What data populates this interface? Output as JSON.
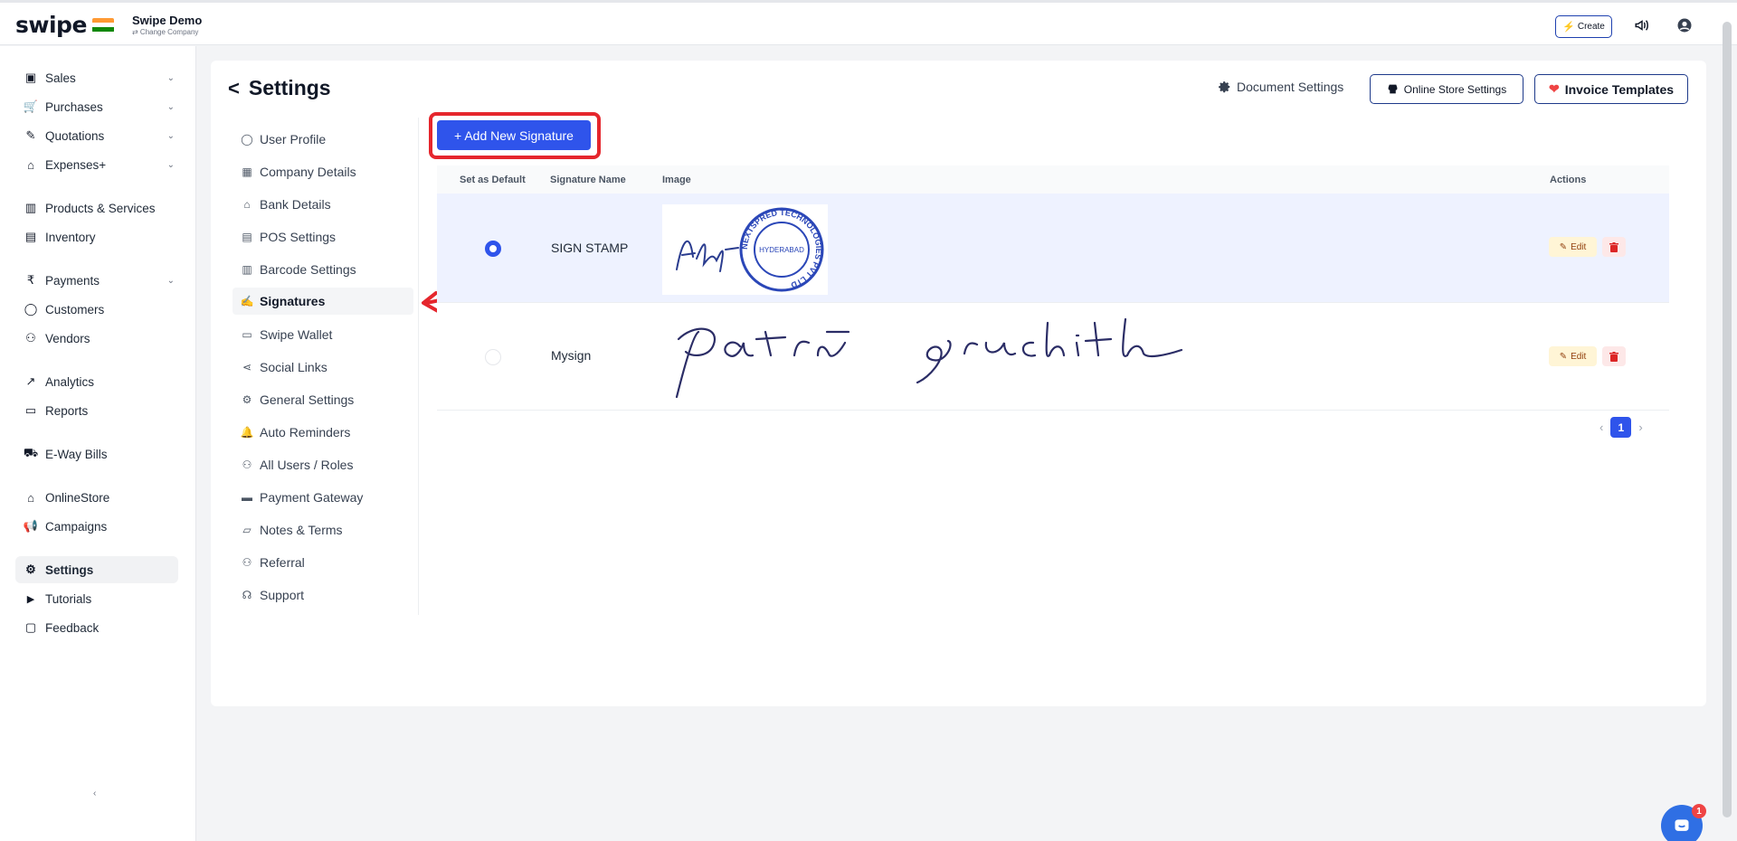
{
  "brand": {
    "logo": "swipe",
    "company_name": "Swipe Demo",
    "change_company": "⇄ Change Company"
  },
  "topbar": {
    "create_label": "Create",
    "bolt": "⚡"
  },
  "sidebar": {
    "items": [
      {
        "label": "Sales",
        "icon": "sales-icon",
        "chev": "⌄"
      },
      {
        "label": "Purchases",
        "icon": "cart-icon",
        "chev": "⌄"
      },
      {
        "label": "Quotations",
        "icon": "pen-icon",
        "chev": "⌄"
      },
      {
        "label": "Expenses+",
        "icon": "tag-icon",
        "chev": "⌄"
      },
      {
        "label": "Products & Services",
        "icon": "barcode-icon"
      },
      {
        "label": "Inventory",
        "icon": "inventory-icon"
      },
      {
        "label": "Payments",
        "icon": "rupee-icon",
        "chev": "⌄"
      },
      {
        "label": "Customers",
        "icon": "user-icon"
      },
      {
        "label": "Vendors",
        "icon": "users-icon"
      },
      {
        "label": "Analytics",
        "icon": "chart-icon"
      },
      {
        "label": "Reports",
        "icon": "report-icon"
      },
      {
        "label": "E-Way Bills",
        "icon": "truck-icon"
      },
      {
        "label": "OnlineStore",
        "icon": "store-icon"
      },
      {
        "label": "Campaigns",
        "icon": "megaphone-icon"
      },
      {
        "label": "Settings",
        "icon": "gear-icon"
      },
      {
        "label": "Tutorials",
        "icon": "youtube-icon"
      },
      {
        "label": "Feedback",
        "icon": "chat-icon"
      }
    ],
    "bottom_mark": "‹"
  },
  "page": {
    "title": "Settings",
    "back": "<"
  },
  "header": {
    "document_settings": "Document Settings",
    "online_store_settings": "Online Store Settings",
    "invoice_templates": "Invoice Templates"
  },
  "submenu": {
    "items": [
      {
        "label": "User Profile",
        "icon": "user-icon"
      },
      {
        "label": "Company Details",
        "icon": "building-icon"
      },
      {
        "label": "Bank Details",
        "icon": "bank-icon"
      },
      {
        "label": "POS Settings",
        "icon": "pos-icon"
      },
      {
        "label": "Barcode Settings",
        "icon": "barcode-icon"
      },
      {
        "label": "Signatures",
        "icon": "signature-icon"
      },
      {
        "label": "Swipe Wallet",
        "icon": "wallet-icon"
      },
      {
        "label": "Social Links",
        "icon": "share-icon"
      },
      {
        "label": "General Settings",
        "icon": "gear-icon"
      },
      {
        "label": "Auto Reminders",
        "icon": "bell-icon"
      },
      {
        "label": "All Users / Roles",
        "icon": "users-icon"
      },
      {
        "label": "Payment Gateway",
        "icon": "card-icon"
      },
      {
        "label": "Notes & Terms",
        "icon": "note-icon"
      },
      {
        "label": "Referral",
        "icon": "referral-icon"
      },
      {
        "label": "Support",
        "icon": "headset-icon"
      }
    ]
  },
  "signatures": {
    "add_label": "+ Add New Signature",
    "columns": {
      "default": "Set as Default",
      "name": "Signature Name",
      "image": "Image",
      "actions": "Actions"
    },
    "rows": [
      {
        "name": "SIGN STAMP",
        "is_default": true,
        "image_kind": "stamp",
        "stamp_text": "NEXTSPRED TECHNOLOGIES PVT LTD",
        "stamp_city": "HYDERABAD",
        "edit": "Edit"
      },
      {
        "name": "Mysign",
        "is_default": false,
        "image_kind": "script",
        "script_text": "patri sruchith",
        "edit": "Edit"
      }
    ],
    "page_current": "1",
    "prev": "‹",
    "next": "›"
  },
  "chat": {
    "badge": "1"
  },
  "colors": {
    "primary": "#2f54eb",
    "highlight": "#e5262d",
    "sidebar_active": "#f1f2f4"
  }
}
